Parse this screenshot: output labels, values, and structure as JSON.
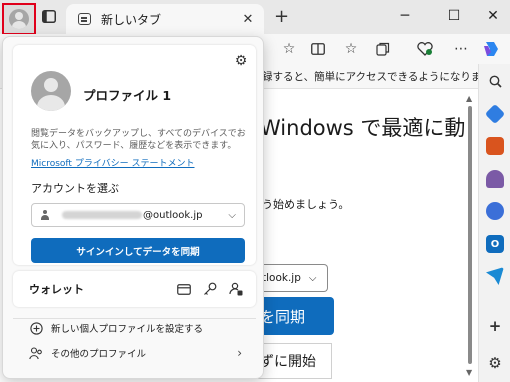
{
  "browser": {
    "tab_title": "新しいタブ",
    "tab_close": "✕",
    "new_tab": "+",
    "window_controls": {
      "minimize": "─",
      "maximize": "☐",
      "close": "✕"
    },
    "favorites_bar_text": "録すると、簡単にアクセスできるようになりま...",
    "icons": [
      "profile-icon",
      "tab-actions-icon",
      "favorite-star-icon",
      "split-screen-icon",
      "favorites-icon",
      "collections-icon",
      "health-icon",
      "more-icon",
      "copilot-icon"
    ]
  },
  "page": {
    "heading": "Windows で最適に動",
    "subtext": "う始めましょう。",
    "account_select_tail": "tlook.jp",
    "primary_button": "を同期",
    "secondary_button": "ずに開始"
  },
  "sidebar": {
    "items": [
      "search-icon",
      "shopping-icon",
      "tools-icon",
      "games-icon",
      "microsoft365-icon",
      "outlook-icon",
      "send-icon",
      "add-icon",
      "settings-icon"
    ],
    "colors": {
      "shopping": "#2f7de1",
      "tools": "#d9541e",
      "games": "#7b5aa6",
      "m365": "#3b6fd8",
      "outlook": "#0f6cbd",
      "send": "#1a8ad4"
    }
  },
  "flyout": {
    "profile_name": "プロファイル 1",
    "sync_description": "閲覧データをバックアップし、すべてのデバイスでお気に入り、パスワード、履歴などを表示できます。",
    "privacy_link": "Microsoft プライバシー ステートメント",
    "choose_account_label": "アカウントを選ぶ",
    "account_domain": "@outlook.jp",
    "sync_button": "サインインしてデータを同期",
    "wallet_label": "ウォレット",
    "add_profile": "新しい個人プロファイルを設定する",
    "other_profiles": "その他のプロファイル"
  },
  "colors": {
    "accent": "#0f6cbd",
    "highlight_border": "#e0001b"
  }
}
